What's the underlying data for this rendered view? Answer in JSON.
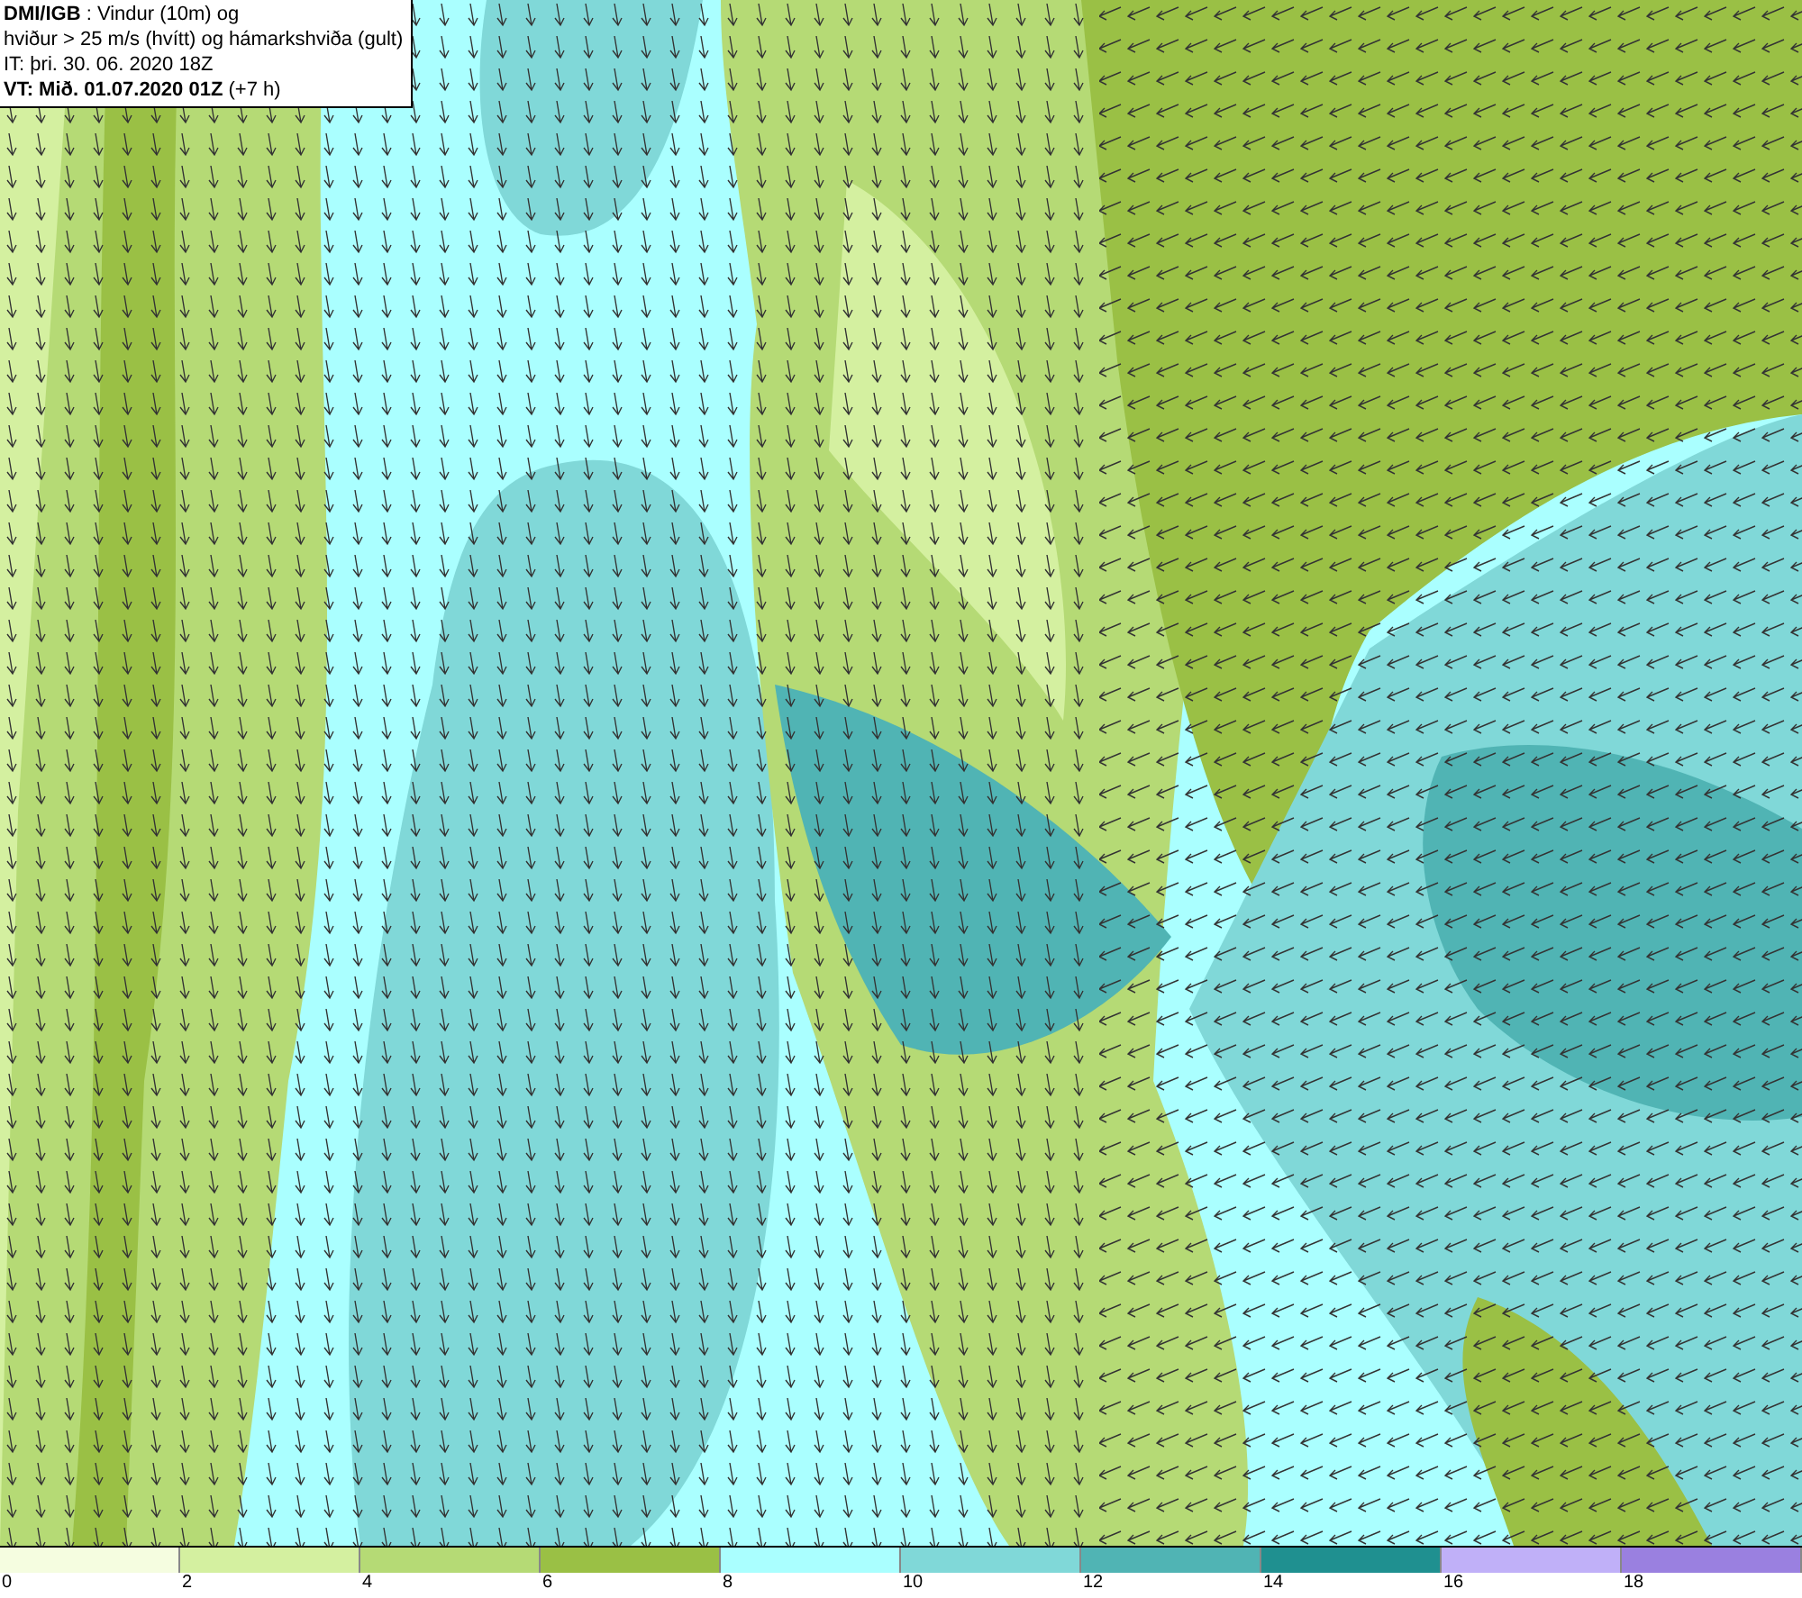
{
  "info_box": {
    "lines": [
      "**DMI/IGB** : Vindur (10m) og",
      "hviður > 25 m/s (hvítt) og hámarkshviða (gult)",
      "IT: þri. 30. 06. 2020 18Z",
      "**VT: Mið. 01.07.2020 01Z** (+7 h)"
    ]
  },
  "legend": {
    "bins": [
      {
        "color": "#f5fde0",
        "label": "0"
      },
      {
        "color": "#d4f0a0",
        "label": "2"
      },
      {
        "color": "#b5da75",
        "label": "4"
      },
      {
        "color": "#9ac045",
        "label": "6"
      },
      {
        "color": "#aaffff",
        "label": "8"
      },
      {
        "color": "#80d8d8",
        "label": "10"
      },
      {
        "color": "#50b4b4",
        "label": "12"
      },
      {
        "color": "#1f9090",
        "label": "14"
      },
      {
        "color": "#c0b0f8",
        "label": "16"
      },
      {
        "color": "#9a80e0",
        "label": "18"
      }
    ]
  }
}
